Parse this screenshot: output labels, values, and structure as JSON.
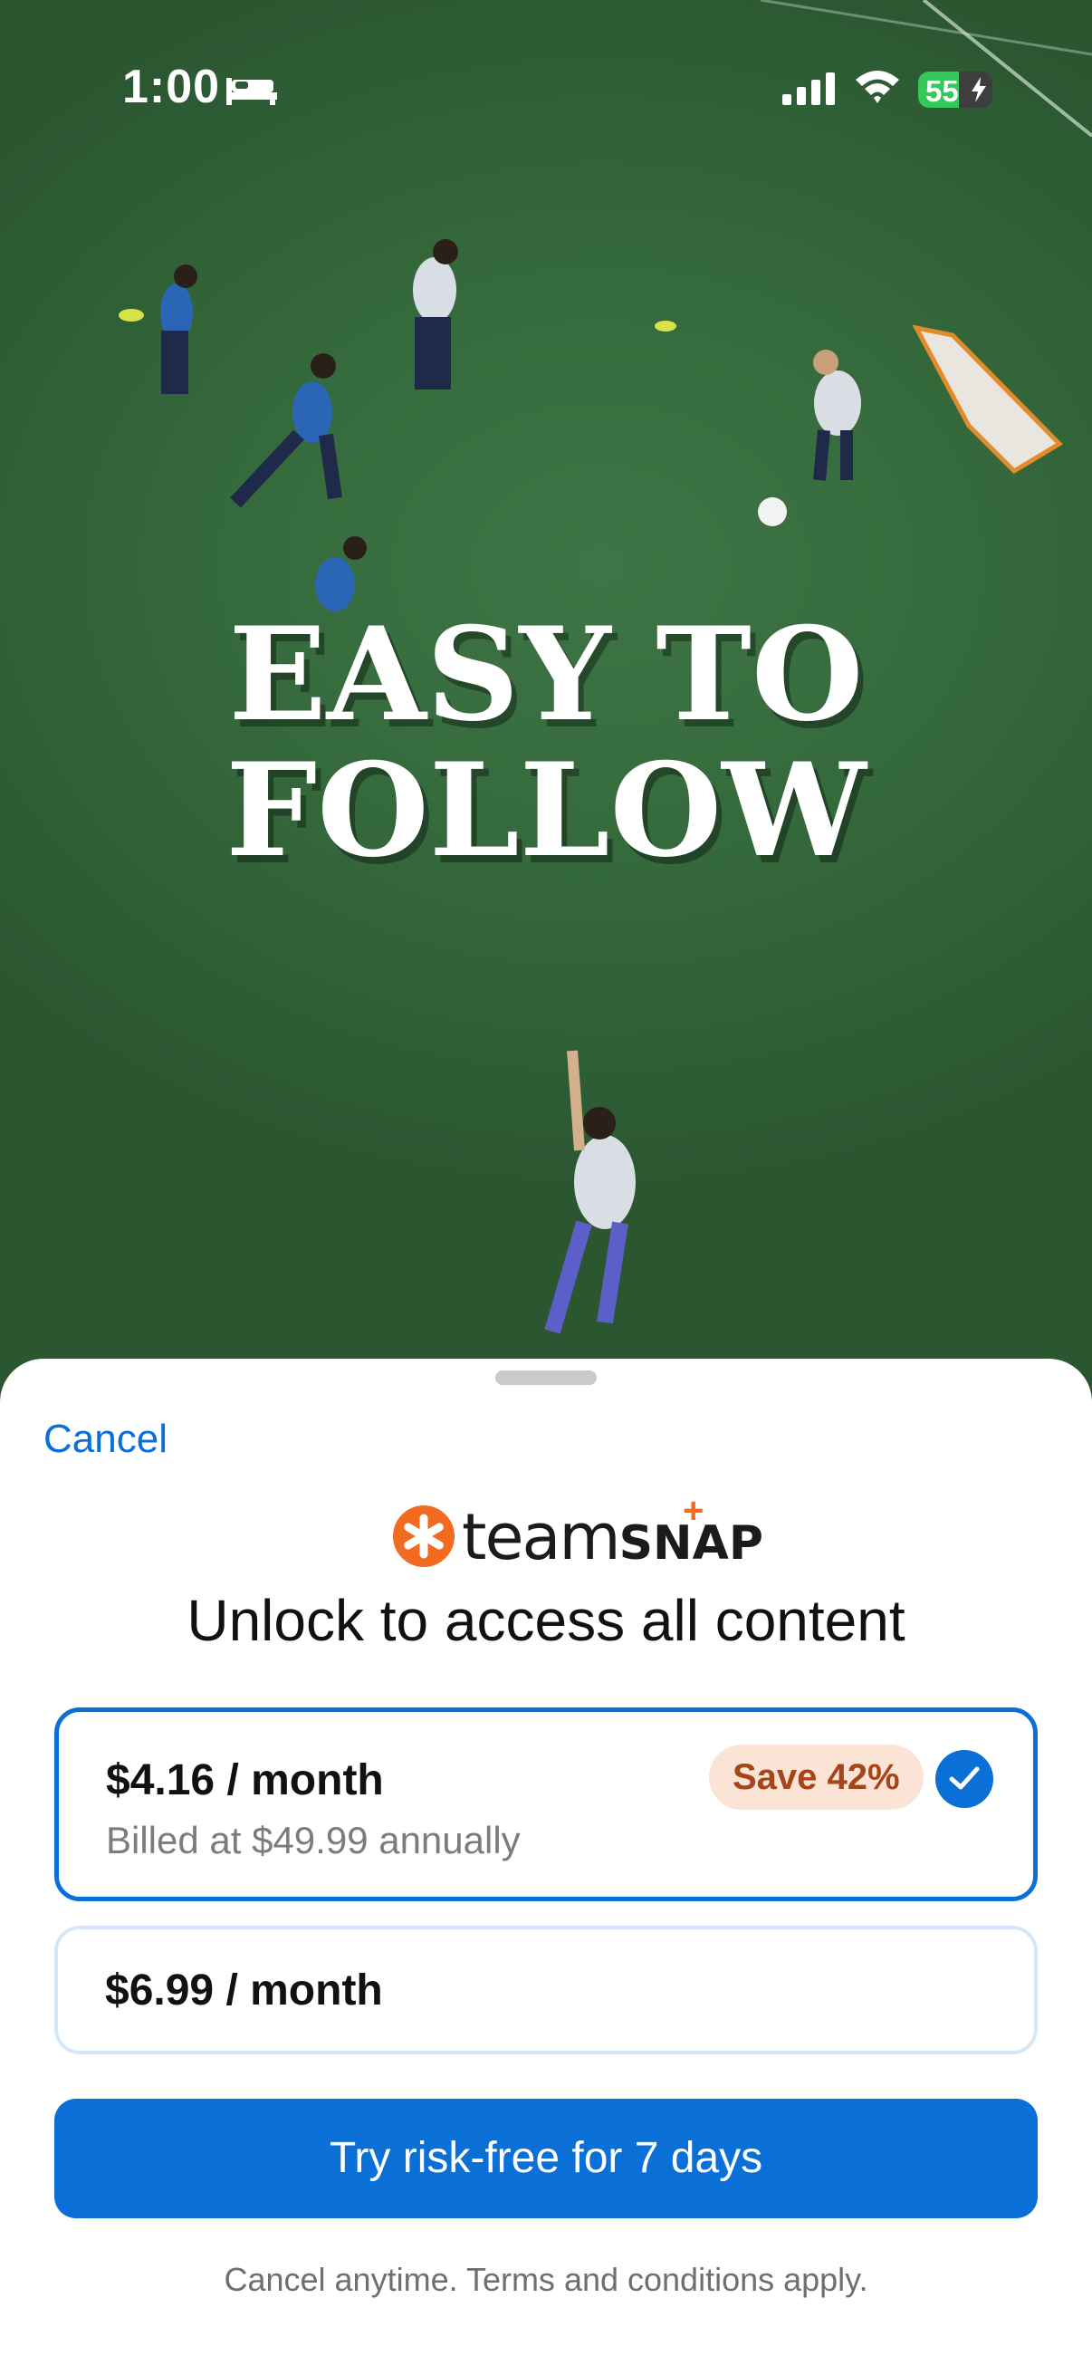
{
  "status_bar": {
    "time": "1:00",
    "battery": "55",
    "icons": [
      "bed-icon",
      "cellular-signal-icon",
      "wifi-icon",
      "battery-charging-icon"
    ]
  },
  "hero": {
    "headline_line1": "EASY TO",
    "headline_line2": "FOLLOW"
  },
  "sheet": {
    "cancel_label": "Cancel",
    "brand": {
      "word1": "team",
      "word2": "SNAP",
      "plus": "+",
      "accent": "#f26b21"
    },
    "headline": "Unlock to access all content",
    "plans": [
      {
        "price": "$4.16 / month",
        "subtitle": "Billed at $49.99 annually",
        "badge": "Save 42%",
        "selected": true
      },
      {
        "price": "$6.99 / month",
        "selected": false
      }
    ],
    "cta_label": "Try risk-free for 7 days",
    "fine_print": "Cancel anytime. Terms and conditions apply."
  },
  "colors": {
    "primary": "#0b6fd8",
    "badge_bg": "#fbe3d6",
    "badge_text": "#a6441a",
    "field": "#3a6f40"
  }
}
